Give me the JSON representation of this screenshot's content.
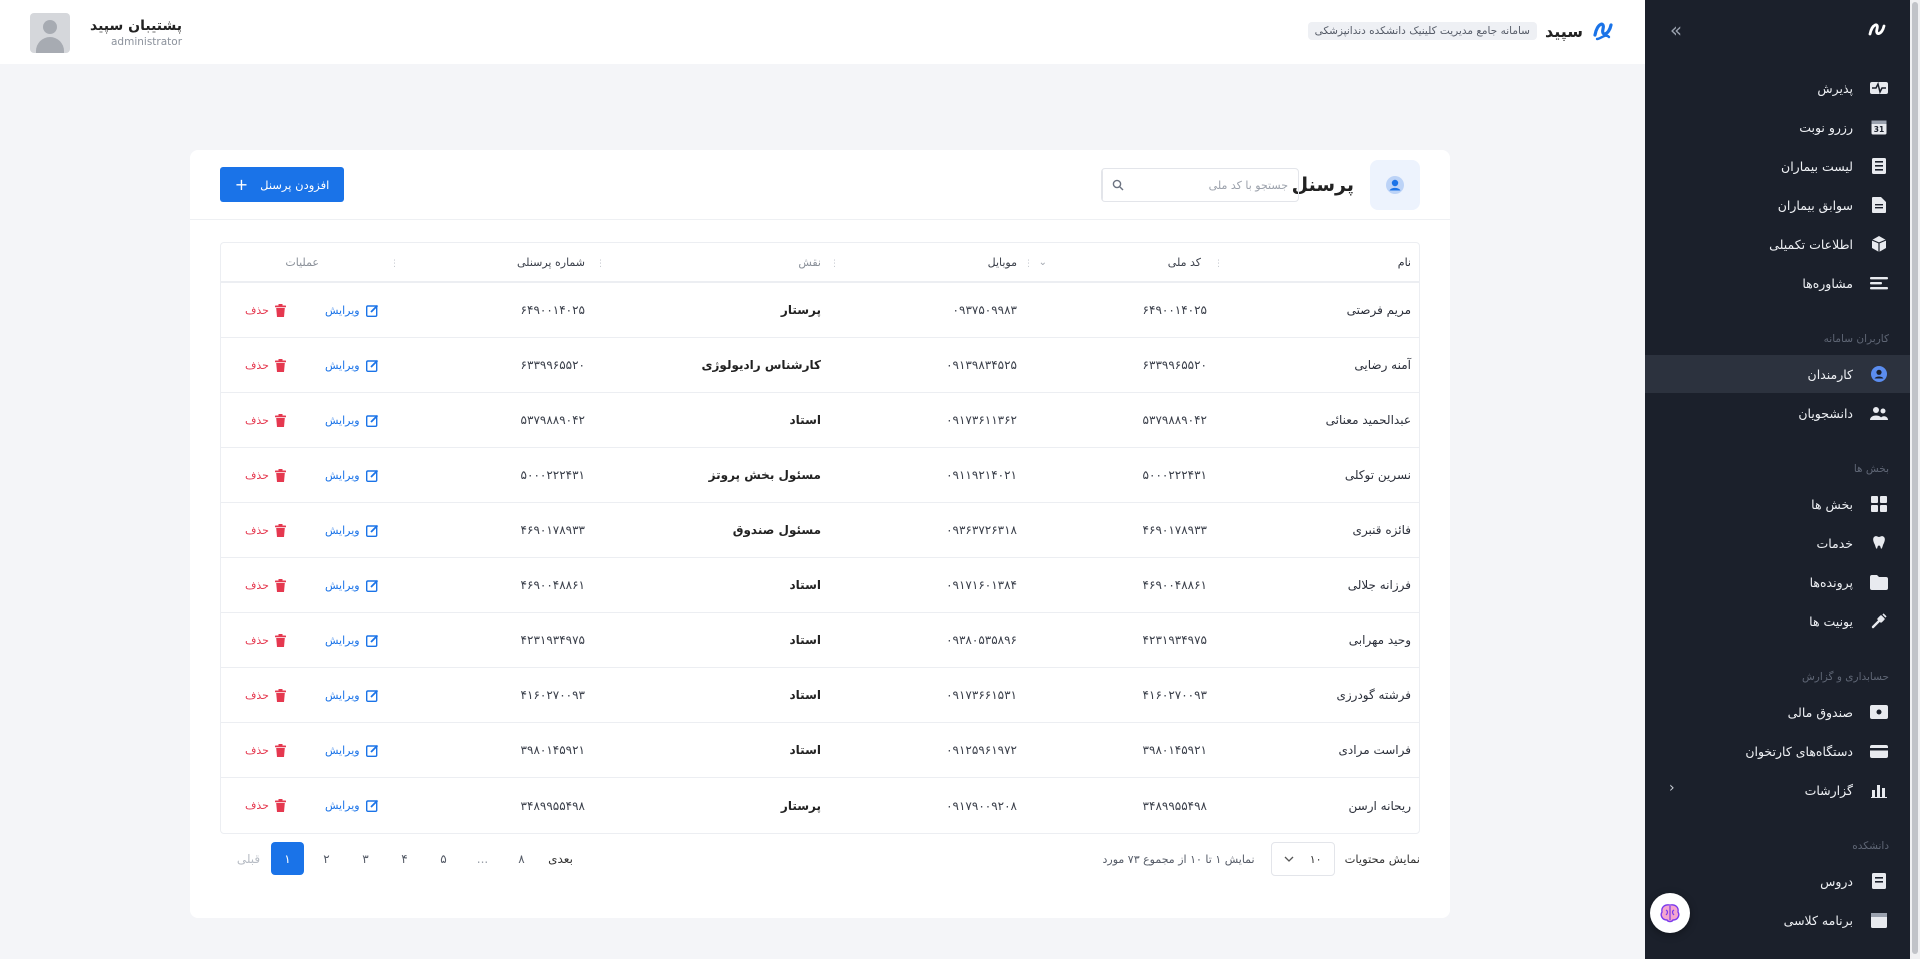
{
  "header": {
    "brand_name": "سپید",
    "brand_subtitle": "سامانه جامع مدیریت کلینیک دانشکده دندانپزشکی",
    "user_name": "پشتیبان سپید",
    "user_role": "administrator"
  },
  "sidebar": {
    "items": [
      {
        "label": "پذیرش",
        "icon": "heartbeat-icon"
      },
      {
        "label": "رزرو نوبت",
        "icon": "calendar-icon",
        "badge": "31"
      },
      {
        "label": "لیست بیماران",
        "icon": "list-icon"
      },
      {
        "label": "سوابق بیماران",
        "icon": "document-icon"
      },
      {
        "label": "اطلاعات تکمیلی",
        "icon": "cube-icon"
      },
      {
        "label": "مشاوره‌ها",
        "icon": "consult-icon"
      }
    ],
    "section_users": "کاربران سامانه",
    "users_items": [
      {
        "label": "کارمندان",
        "icon": "user-circle-icon",
        "active": true
      },
      {
        "label": "دانشجویان",
        "icon": "students-icon"
      }
    ],
    "section_departments": "بخش ها",
    "dept_items": [
      {
        "label": "بخش ها",
        "icon": "grid-icon"
      },
      {
        "label": "خدمات",
        "icon": "tooth-icon"
      },
      {
        "label": "پرونده‌ها",
        "icon": "folder-icon"
      },
      {
        "label": "یونیت ها",
        "icon": "drill-icon"
      }
    ],
    "section_accounting": "حسابداری و گزارش",
    "acc_items": [
      {
        "label": "صندوق مالی",
        "icon": "cashbox-icon"
      },
      {
        "label": "دستگاه‌های کارتخوان",
        "icon": "card-reader-icon"
      },
      {
        "label": "گزارشات",
        "icon": "bar-chart-icon"
      }
    ],
    "section_faculty": "دانشکده",
    "faculty_items": [
      {
        "label": "دروس",
        "icon": "book-icon"
      },
      {
        "label": "برنامه کلاسی",
        "icon": "schedule-icon"
      }
    ]
  },
  "page": {
    "title": "پرسنل",
    "search_placeholder": "جستجو با کد ملی",
    "add_button": "افزودن پرسنل"
  },
  "table": {
    "columns": {
      "name": "نام",
      "national_id": "کد ملی",
      "mobile": "موبایل",
      "role": "نقش",
      "personnel_no": "شماره پرسنلی",
      "ops": "عملیات"
    },
    "edit_label": "ویرایش",
    "delete_label": "حذف",
    "rows": [
      {
        "name": "مریم فرصتی",
        "national_id": "۶۴۹۰۰۱۴۰۲۵",
        "mobile": "۰۹۳۷۵۰۹۹۸۳",
        "role": "پرستار",
        "personnel_no": "۶۴۹۰۰۱۴۰۲۵"
      },
      {
        "name": "آمنه رضایی",
        "national_id": "۶۳۳۹۹۶۵۵۲۰",
        "mobile": "۰۹۱۳۹۸۳۴۵۲۵",
        "role": "کارشناس رادیولوژی",
        "personnel_no": "۶۳۳۹۹۶۵۵۲۰"
      },
      {
        "name": "عبدالحمید معنائی",
        "national_id": "۵۳۷۹۸۸۹۰۴۲",
        "mobile": "۰۹۱۷۳۶۱۱۳۶۲",
        "role": "استاد",
        "personnel_no": "۵۳۷۹۸۸۹۰۴۲"
      },
      {
        "name": "نسرین توکلی",
        "national_id": "۵۰۰۰۲۲۲۴۳۱",
        "mobile": "۰۹۱۱۹۲۱۴۰۲۱",
        "role": "مسئول بخش پروتز",
        "personnel_no": "۵۰۰۰۲۲۲۴۳۱"
      },
      {
        "name": "فائزه قنبری",
        "national_id": "۴۶۹۰۱۷۸۹۳۳",
        "mobile": "۰۹۳۶۳۷۲۶۳۱۸",
        "role": "مسئول صندوق",
        "personnel_no": "۴۶۹۰۱۷۸۹۳۳"
      },
      {
        "name": "فرزانه جلالی",
        "national_id": "۴۶۹۰۰۴۸۸۶۱",
        "mobile": "۰۹۱۷۱۶۰۱۳۸۴",
        "role": "استاد",
        "personnel_no": "۴۶۹۰۰۴۸۸۶۱"
      },
      {
        "name": "وحید مهرابی",
        "national_id": "۴۲۳۱۹۳۴۹۷۵",
        "mobile": "۰۹۳۸۰۵۳۵۸۹۶",
        "role": "استاد",
        "personnel_no": "۴۲۳۱۹۳۴۹۷۵"
      },
      {
        "name": "فرشته گودرزی",
        "national_id": "۴۱۶۰۲۷۰۰۹۳",
        "mobile": "۰۹۱۷۳۶۶۱۵۳۱",
        "role": "استاد",
        "personnel_no": "۴۱۶۰۲۷۰۰۹۳"
      },
      {
        "name": "فراست مرادی",
        "national_id": "۳۹۸۰۱۴۵۹۲۱",
        "mobile": "۰۹۱۲۵۹۶۱۹۷۲",
        "role": "استاد",
        "personnel_no": "۳۹۸۰۱۴۵۹۲۱"
      },
      {
        "name": "ریحانه ارسن",
        "national_id": "۳۴۸۹۹۵۵۴۹۸",
        "mobile": "۰۹۱۷۹۰۰۹۲۰۸",
        "role": "پرستار",
        "personnel_no": "۳۴۸۹۹۵۵۴۹۸"
      }
    ]
  },
  "footer": {
    "per_page_label": "نمایش محتویات",
    "per_page_value": "۱۰",
    "showing_info": "نمایش ۱ تا ۱۰ از مجموع ۷۳ مورد",
    "prev": "قبلی",
    "next": "بعدی",
    "pages": [
      "۱",
      "۲",
      "۳",
      "۴",
      "۵",
      "...",
      "۸"
    ],
    "active_page": "۱"
  },
  "colors": {
    "primary": "#1a73e8",
    "danger": "#e5384f",
    "sidebar_bg": "#1b202b"
  }
}
